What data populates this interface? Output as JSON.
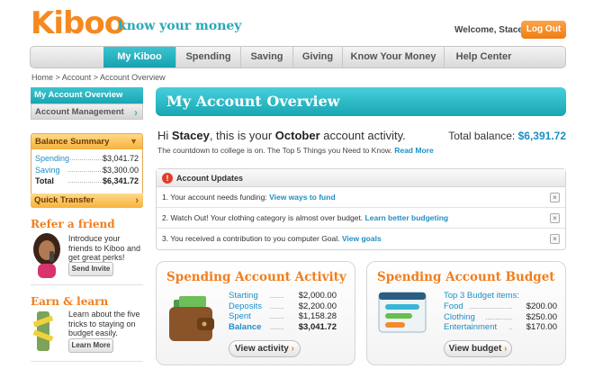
{
  "header": {
    "logo": "Kiboo",
    "tagline": "know your money",
    "welcome": "Welcome, Stacey",
    "logout_label": "Log Out"
  },
  "nav": {
    "items": [
      "My Kiboo",
      "Spending",
      "Saving",
      "Giving",
      "Know Your Money",
      "Help Center"
    ],
    "active": "My Kiboo"
  },
  "breadcrumb": "Home > Account > Account Overview",
  "sidebar": {
    "overview": "My Account Overview",
    "management": "Account Management",
    "balance_summary": {
      "title": "Balance Summary",
      "rows": [
        {
          "label": "Spending",
          "amount": "$3,041.72"
        },
        {
          "label": "Saving",
          "amount": "$3,300.00"
        },
        {
          "label": "Total",
          "amount": "$6,341.72"
        }
      ],
      "quick_transfer": "Quick Transfer"
    },
    "refer": {
      "title": "Refer a friend",
      "text": "Introduce your friends to Kiboo and get great perks!",
      "button": "Send Invite"
    },
    "learn": {
      "title": "Earn & learn",
      "text": "Learn about the five tricks to staying on budget easily.",
      "button": "Learn More"
    }
  },
  "main": {
    "title": "My Account Overview",
    "greeting_pre": "Hi ",
    "greeting_name": "Stacey",
    "greeting_mid": ", this is your ",
    "greeting_month": "October",
    "greeting_post": " account activity.",
    "countdown": "The countdown to college is on. The Top 5 Things you Need to Know.",
    "read_more": "Read More",
    "total_balance_label": "Total balance:",
    "total_balance": "$6,391.72",
    "updates": {
      "title": "Account Updates",
      "items": [
        {
          "text": "1. Your account needs funding:",
          "link": "View ways to fund"
        },
        {
          "text": "2. Watch Out! Your clothing category is almost over budget. Learn better budgeting.",
          "link": "Learn better budgeting"
        },
        {
          "text": "3. You received a contribution to you computer Goal.",
          "link": "View goals"
        }
      ]
    },
    "activity": {
      "title": "Spending Account Activity",
      "rows": [
        {
          "label": "Starting",
          "amount": "$2,000.00"
        },
        {
          "label": "Deposits",
          "amount": "$2,200.00"
        },
        {
          "label": "Spent",
          "amount": "$1,158.28"
        },
        {
          "label": "Balance",
          "amount": "$3,041.72"
        }
      ],
      "button": "View activity"
    },
    "budget": {
      "title": "Spending Account Budget",
      "heading": "Top 3 Budget items:",
      "rows": [
        {
          "label": "Food",
          "amount": "$200.00"
        },
        {
          "label": "Clothing",
          "amount": "$250.00"
        },
        {
          "label": "Entertainment",
          "amount": "$170.00"
        }
      ],
      "button": "View budget"
    }
  },
  "colors": {
    "teal": "#18a5b3",
    "orange": "#f07e1e",
    "link": "#1d8fc6"
  }
}
